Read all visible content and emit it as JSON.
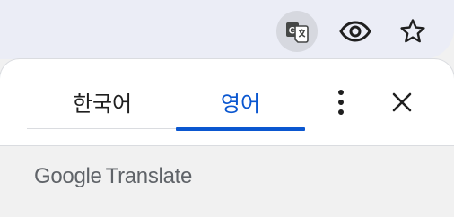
{
  "toolbar": {
    "icons": [
      "google-translate-icon",
      "eye-icon",
      "star-icon"
    ],
    "translate_active": true
  },
  "translate_bubble": {
    "tabs": [
      {
        "label": "한국어",
        "selected": false
      },
      {
        "label": "영어",
        "selected": true
      }
    ],
    "brand": {
      "google": "Google",
      "product": "Translate"
    }
  },
  "colors": {
    "accent": "#0b57d0",
    "text": "#1f1f1f",
    "muted": "#5f6368",
    "toolbar_bg": "#ebedf6",
    "footer_bg": "#f1f1f1"
  }
}
